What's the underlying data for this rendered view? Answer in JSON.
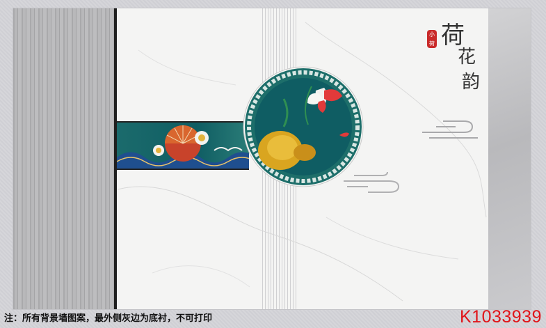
{
  "design": {
    "title": {
      "chars": [
        "荷",
        "花",
        "韵"
      ],
      "seal_text": "小荷"
    },
    "colors": {
      "accent_red": "#e0151a",
      "teal": "#0f5d63",
      "gold": "#d9a520",
      "marble": "#f4f4f3",
      "wood_gray": "#b0b0b2"
    }
  },
  "footer": {
    "note": "注：所有背景墙图案，最外侧灰边为底衬，不可打印",
    "product_code": "K1033939"
  }
}
